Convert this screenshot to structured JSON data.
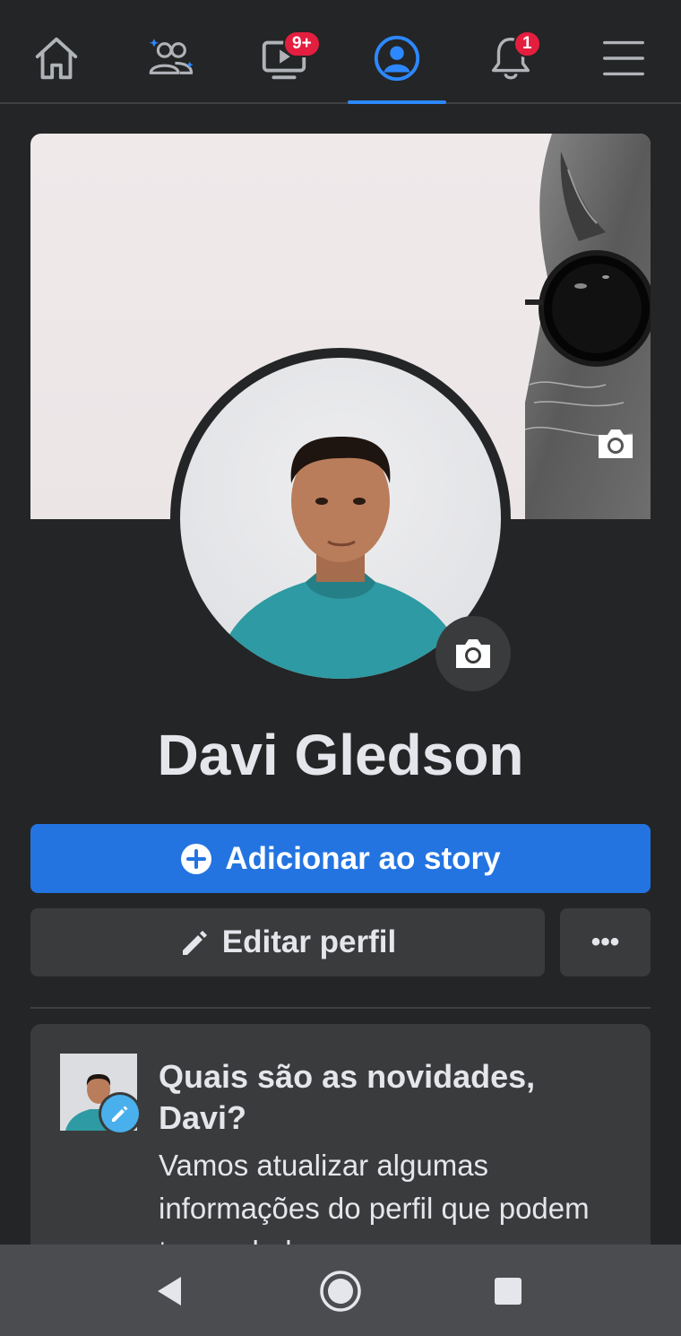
{
  "nav": {
    "video_badge": "9+",
    "notifications_badge": "1",
    "active_tab": "profile"
  },
  "profile": {
    "name": "Davi Gledson"
  },
  "actions": {
    "add_story_label": "Adicionar ao story",
    "edit_profile_label": "Editar perfil",
    "more_label": "•••"
  },
  "card": {
    "title": "Quais são as novidades, Davi?",
    "body": "Vamos atualizar algumas informações do perfil que podem ter mudado."
  },
  "colors": {
    "background": "#242526",
    "accent": "#2d88ff",
    "primary_button": "#2374e1",
    "secondary_button": "#3a3b3c",
    "badge": "#e41e3f"
  }
}
